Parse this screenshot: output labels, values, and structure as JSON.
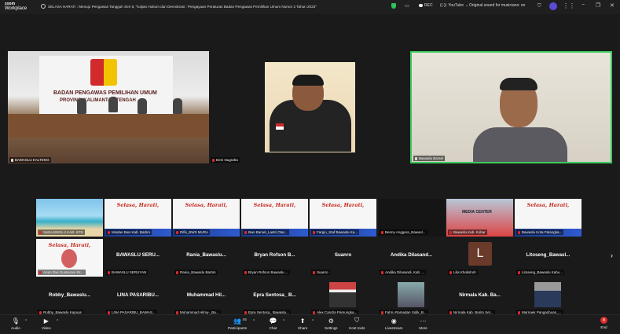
{
  "app": {
    "brand_top": "zoom",
    "brand_bottom": "Workplace"
  },
  "meeting": {
    "title": "SELASA HARATI : Menuju Pengawas Tangguh Seri 8, \"Kajian Hukum dan Demokrasi : Pengayaan Peraturan Badan Pengawas Pemilihan Umum Nomor 2 Tahun 2023\""
  },
  "status_bar": {
    "rec": "REC",
    "youtube": "YouTube",
    "audio_mode": "Original sound for musicians: on"
  },
  "main_speakers": [
    {
      "name": "BAWASLU KALTENG",
      "mic": "unmuted"
    },
    {
      "name": "Deni Nugraha",
      "mic": "muted"
    },
    {
      "name": "Bawaslu Barsel",
      "mic": "unmuted"
    }
  ],
  "hall_banner": {
    "line1": "BADAN PENGAWAS PEMILIHAN UMUM",
    "line2": "PROVINSI KALIMANTAN TENGAH"
  },
  "gallery_row1": [
    {
      "name": "Satria BWSLU KAB. KPS",
      "kind": "beach"
    },
    {
      "name": "Misdan Bws Kab. Bartim",
      "kind": "selasa"
    },
    {
      "name": "Rifki_BWS MURA",
      "kind": "selasa"
    },
    {
      "name": "Bws Barsel_Lastri Otar...",
      "kind": "selasa"
    },
    {
      "name": "Fargio_Staf Bawaslu Ka...",
      "kind": "selasa"
    },
    {
      "name": "Benny Anggara_Bawasl...",
      "kind": "dark"
    },
    {
      "name": "Bawaslu Kab. Kobar",
      "kind": "mediacenter"
    },
    {
      "name": "Bawaslu Kota Palangka...",
      "kind": "selasa"
    }
  ],
  "selasa_text": "Selasa, Harati,",
  "media_center": "MEDIA CENTER",
  "gallery_row2": [
    {
      "name": "Arum Dwi Gustiarani Ek...",
      "display": ""
    },
    {
      "name": "BAWASLU SERUYAN",
      "display": "BAWASLU SERU..."
    },
    {
      "name": "Rania_Bawaslu Bartim",
      "display": "Rania_Bawaslu..."
    },
    {
      "name": "Bryan Rofson Bawaslu ...",
      "display": "Bryan Rofson B..."
    },
    {
      "name": "Suanro",
      "display": "Suanro"
    },
    {
      "name": "Andika Dilasandi, Kab. ...",
      "display": "Andika Dilasand..."
    },
    {
      "name": "Lilis Kholishoh",
      "display": "",
      "letter": "L"
    },
    {
      "name": "Litoseng_Bawaslu Kabu...",
      "display": "Litoseng_Bawasl..."
    }
  ],
  "gallery_row3": [
    {
      "name": "Robby_Bawaslu Kapuas",
      "display": "Robby_Bawaslu..."
    },
    {
      "name": "LINA PASARIBU_BAWAS...",
      "display": "LINA PASARIBU..."
    },
    {
      "name": "Muhammad Hilmy-_Ba...",
      "display": "Muhammad Hil..."
    },
    {
      "name": "Epra Sentosa_ Bawaslu...",
      "display": "Epra Sentosa_ B..."
    },
    {
      "name": "Alex Candra Pamungka...",
      "display": ""
    },
    {
      "name": "Fahru Ramadan Sidik_B...",
      "display": ""
    },
    {
      "name": "Nirmala Kab. Barito Sel...",
      "display": "Nirmala Kab. Ba..."
    },
    {
      "name": "Marnaek Pangaribuan_...",
      "display": ""
    }
  ],
  "toolbar": {
    "audio": "Audio",
    "video": "Video",
    "participants": "Participants",
    "participant_count": "85",
    "chat": "Chat",
    "share": "Share",
    "settings": "Settings",
    "host_tools": "Host tools",
    "livestream": "Livestream",
    "more": "More",
    "end": "End"
  }
}
